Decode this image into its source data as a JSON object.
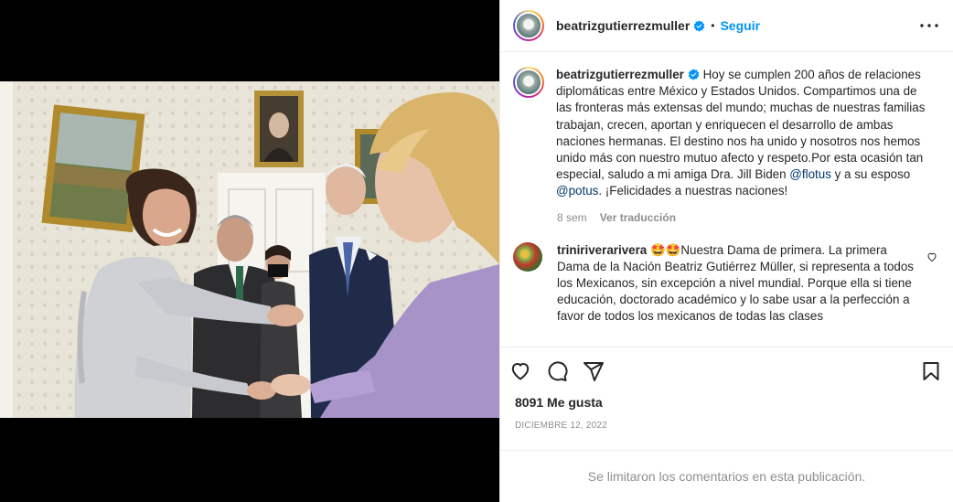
{
  "post": {
    "username": "beatrizgutierrezmuller",
    "follow_label": "Seguir",
    "separator": "•",
    "photo_alt": "Foto",
    "caption": {
      "part1": " Hoy se cumplen 200 años de relaciones diplomáticas entre México y Estados Unidos. Compartimos una de las fronteras más extensas del mundo; muchas de nuestras familias trabajan, crecen, aportan y enriquecen el desarrollo de ambas naciones hermanas. El destino nos ha unido y nosotros nos hemos unido más con nuestro mutuo afecto y respeto.Por esta ocasión tan especial, saludo a mi amiga Dra. Jill Biden ",
      "mention1": "@flotus",
      "part2": " y a su esposo ",
      "mention2": "@potus",
      "part3": ". ¡Felicidades a nuestras naciones!"
    },
    "caption_time": "8 sem",
    "translate_label": "Ver traducción",
    "comment": {
      "username": "triniriverarivera",
      "emojis": "🤩🤩",
      "text": "Nuestra Dama de primera. La primera Dama de la Nación Beatriz Gutiérrez Müller, si representa a todos los Mexicanos, sin excepción a nivel mundial. Porque ella si tiene educación, doctorado académico y lo sabe usar a la perfección a favor de todos los mexicanos de todas las clases"
    },
    "likes": "8091 Me gusta",
    "date": "DICIEMBRE 12, 2022",
    "comments_limited": "Se limitaron los comentarios en esta publicación."
  },
  "icons": {
    "verified": "verified-badge-icon",
    "more": "more-options-icon",
    "like": "heart-icon",
    "comment": "comment-icon",
    "share": "share-icon",
    "save": "bookmark-icon",
    "comment_like": "small-heart-icon"
  },
  "colors": {
    "accent": "#0095f6",
    "secondary_text": "#8e8e8e",
    "mention": "#00376b",
    "primary_text": "#262626"
  }
}
